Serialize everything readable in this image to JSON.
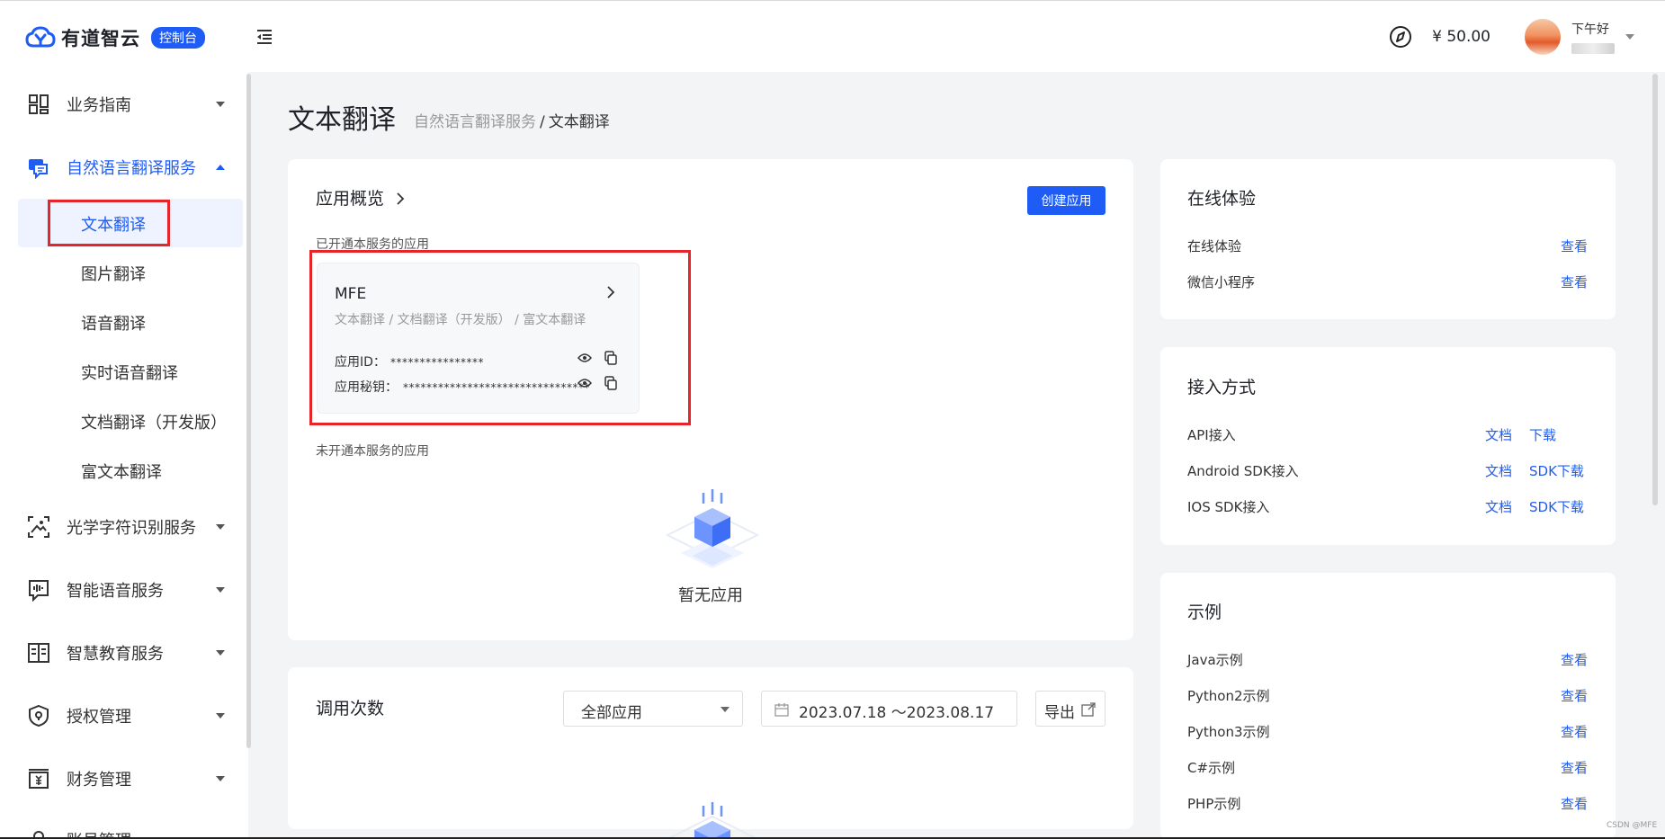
{
  "header": {
    "logo_text": "有道智云",
    "console_badge": "控制台",
    "balance": "¥ 50.00",
    "greeting": "下午好"
  },
  "sidebar": {
    "groups": [
      {
        "label": "业务指南",
        "icon": "grid-icon"
      },
      {
        "label": "自然语言翻译服务",
        "icon": "translate-chat-icon",
        "expanded": true
      },
      {
        "label": "光学字符识别服务",
        "icon": "scan-image-icon"
      },
      {
        "label": "智能语音服务",
        "icon": "voice-wave-icon"
      },
      {
        "label": "智慧教育服务",
        "icon": "book-icon"
      },
      {
        "label": "授权管理",
        "icon": "shield-icon"
      },
      {
        "label": "财务管理",
        "icon": "finance-icon"
      },
      {
        "label": "账号管理",
        "icon": "user-icon"
      }
    ],
    "sub_items": [
      "文本翻译",
      "图片翻译",
      "语音翻译",
      "实时语音翻译",
      "文档翻译（开发版）",
      "富文本翻译"
    ]
  },
  "main": {
    "title": "文本翻译",
    "breadcrumb": {
      "parent": "自然语言翻译服务",
      "separator": "/",
      "current": "文本翻译"
    },
    "overview": {
      "title": "应用概览",
      "create_button": "创建应用",
      "enabled_label": "已开通本服务的应用",
      "app": {
        "name": "MFE",
        "services": "文本翻译 / 文档翻译（开发版） / 富文本翻译",
        "id_label": "应用ID：",
        "id_value": "****************",
        "secret_label": "应用秘钥：",
        "secret_value": "********************************"
      },
      "disabled_label": "未开通本服务的应用",
      "empty_text": "暂无应用"
    },
    "calls": {
      "title": "调用次数",
      "select_value": "全部应用",
      "date_range": "2023.07.18 ～2023.08.17",
      "export_label": "导出"
    }
  },
  "right_panel": {
    "online": {
      "title": "在线体验",
      "rows": [
        {
          "label": "在线体验",
          "link": "查看"
        },
        {
          "label": "微信小程序",
          "link": "查看"
        }
      ]
    },
    "access": {
      "title": "接入方式",
      "rows": [
        {
          "label": "API接入",
          "link1": "文档",
          "link2": "下载"
        },
        {
          "label": "Android SDK接入",
          "link1": "文档",
          "link2": "SDK下载"
        },
        {
          "label": "IOS SDK接入",
          "link1": "文档",
          "link2": "SDK下载"
        }
      ]
    },
    "examples": {
      "title": "示例",
      "rows": [
        {
          "label": "Java示例",
          "link": "查看"
        },
        {
          "label": "Python2示例",
          "link": "查看"
        },
        {
          "label": "Python3示例",
          "link": "查看"
        },
        {
          "label": "C#示例",
          "link": "查看"
        },
        {
          "label": "PHP示例",
          "link": "查看"
        }
      ]
    }
  },
  "watermark": "CSDN @MFE",
  "colors": {
    "accent": "#1f5cf5",
    "highlight_box": "#e4262b"
  }
}
